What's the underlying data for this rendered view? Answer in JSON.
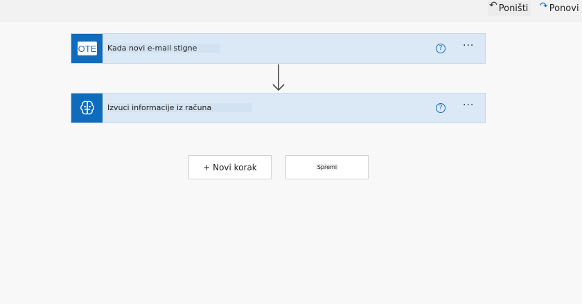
{
  "toolbar": {
    "undo_label": "Poništi",
    "undo_icon": "undo-icon",
    "redo_label": "Ponovi",
    "redo_icon": "redo-icon"
  },
  "flow": {
    "steps": [
      {
        "icon_text": "OTE",
        "icon": "outlook-icon",
        "title": "Kada novi e-mail stigne",
        "help": "?",
        "more": "···"
      },
      {
        "icon": "ai-brain-icon",
        "title": "Izvuci informacije iz računa",
        "help": "?",
        "more": "···"
      }
    ]
  },
  "actions": {
    "new_step_label": "+ Novi korak",
    "save_label": "Spremi"
  },
  "colors": {
    "accent": "#0f6cbd",
    "card_background": "#dbe9f6",
    "page_background": "#f8f8f8"
  }
}
